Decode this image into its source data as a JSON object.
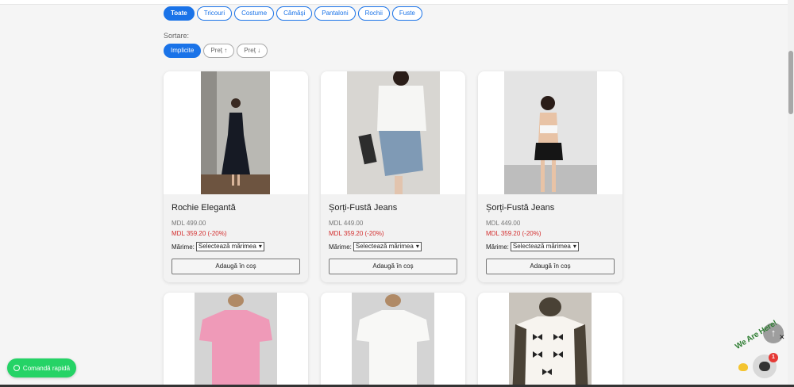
{
  "categories": [
    "Toate",
    "Tricouri",
    "Costume",
    "Cămăși",
    "Pantaloni",
    "Rochii",
    "Fuste"
  ],
  "sort": {
    "label": "Sortare:",
    "options": [
      "Implicite",
      "Preț ↑",
      "Preț ↓"
    ]
  },
  "products": [
    {
      "name": "Rochie Elegantă",
      "old_price": "MDL 499.00",
      "new_price": "MDL 359.20 (-20%)",
      "size_label": "Mărime:",
      "size_select": "Selectează mărimea",
      "add_label": "Adaugă în coș"
    },
    {
      "name": "Șorți-Fustă Jeans",
      "old_price": "MDL 449.00",
      "new_price": "MDL 359.20 (-20%)",
      "size_label": "Mărime:",
      "size_select": "Selectează mărimea",
      "add_label": "Adaugă în coș"
    },
    {
      "name": "Șorți-Fustă Jeans",
      "old_price": "MDL 449.00",
      "new_price": "MDL 359.20 (-20%)",
      "size_label": "Mărime:",
      "size_select": "Selectează mărimea",
      "add_label": "Adaugă în coș"
    }
  ],
  "quick_order": "Comandă rapidă",
  "chat": {
    "badge": "1",
    "tagline": "We Are Here!"
  },
  "icons": {
    "scroll_top": "arrow-up-icon",
    "close": "close-icon",
    "chat": "chat-bubble-icon",
    "whatsapp": "whatsapp-icon"
  },
  "colors": {
    "accent": "#1a73e8",
    "sale": "#d32f2f",
    "whatsapp": "#25d366"
  }
}
